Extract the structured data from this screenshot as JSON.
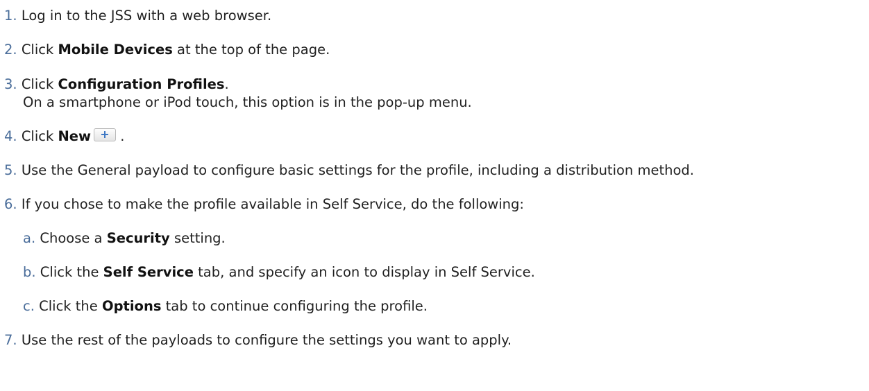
{
  "steps": [
    {
      "num": "1.",
      "parts": [
        "Log in to the JSS with a web browser."
      ]
    },
    {
      "num": "2.",
      "pre": "Click ",
      "bold": "Mobile Devices",
      "post": " at the top of the page."
    },
    {
      "num": "3.",
      "pre": "Click ",
      "bold": "Configuration Profiles",
      "post": ".",
      "continuation": "On a smartphone or iPod touch, this option is in the pop-up menu."
    },
    {
      "num": "4.",
      "pre": "Click ",
      "bold": "New",
      "post": " ."
    },
    {
      "num": "5.",
      "text": "Use the General payload to configure basic settings for the profile, including a distribution method."
    },
    {
      "num": "6.",
      "text": "If you chose to make the profile available in Self Service, do the following:"
    },
    {
      "num": "7.",
      "text": "Use the rest of the payloads to configure the settings you want to apply."
    }
  ],
  "substeps": [
    {
      "num": "a.",
      "pre": "Choose a ",
      "bold": "Security",
      "post": " setting."
    },
    {
      "num": "b.",
      "pre": "Click the ",
      "bold": "Self Service",
      "post": " tab, and specify an icon to display in Self Service."
    },
    {
      "num": "c.",
      "pre": "Click the ",
      "bold": "Options",
      "post": " tab to continue configuring the profile."
    }
  ],
  "icons": {
    "new_button_icon": "plus-icon",
    "plus_color": "#3f78c4"
  }
}
